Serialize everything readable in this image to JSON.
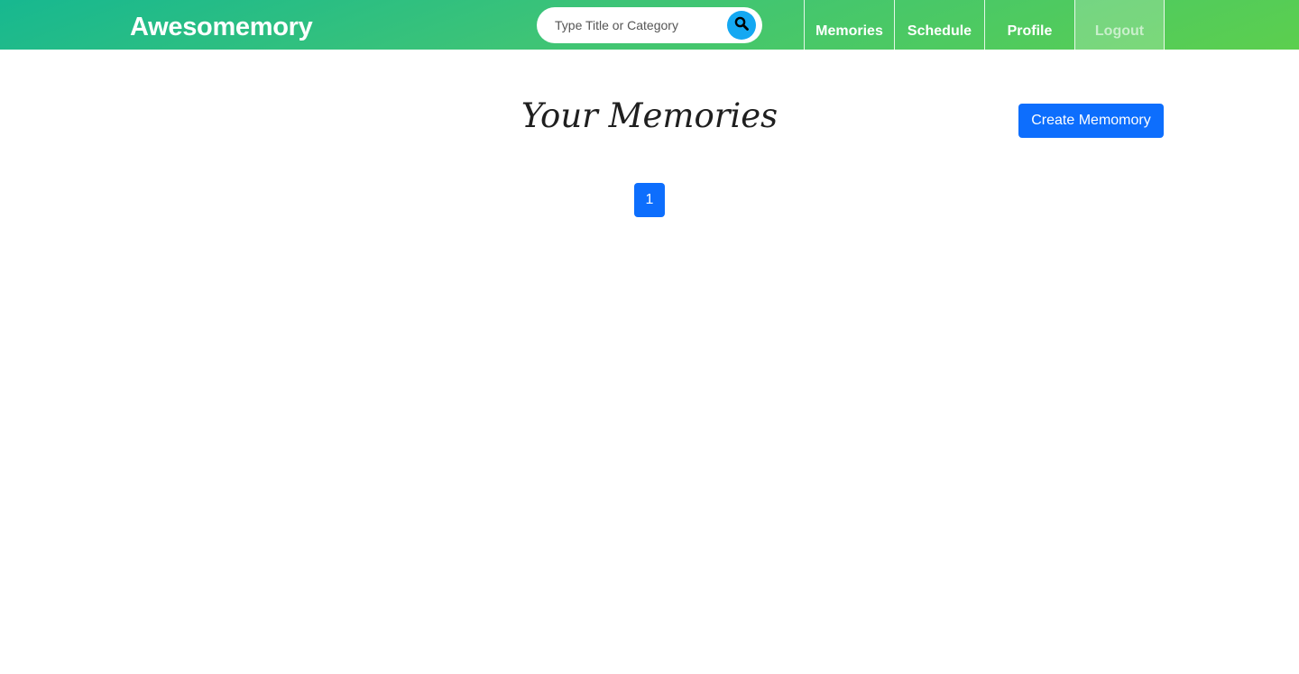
{
  "header": {
    "brand": "Awesomemory",
    "search": {
      "placeholder": "Type Title or Category",
      "value": "",
      "icon": "search-icon"
    },
    "nav": [
      {
        "label": "Memories"
      },
      {
        "label": "Schedule"
      },
      {
        "label": "Profile"
      },
      {
        "label": "Logout"
      }
    ]
  },
  "main": {
    "title": "Your Memories",
    "create_label": "Create Memomory",
    "pagination": {
      "pages": [
        "1"
      ],
      "current": "1"
    }
  },
  "colors": {
    "header_gradient_start": "#17b890",
    "header_gradient_end": "#5ccf4e",
    "primary": "#0d6efd",
    "search_button": "#14a8f2"
  }
}
